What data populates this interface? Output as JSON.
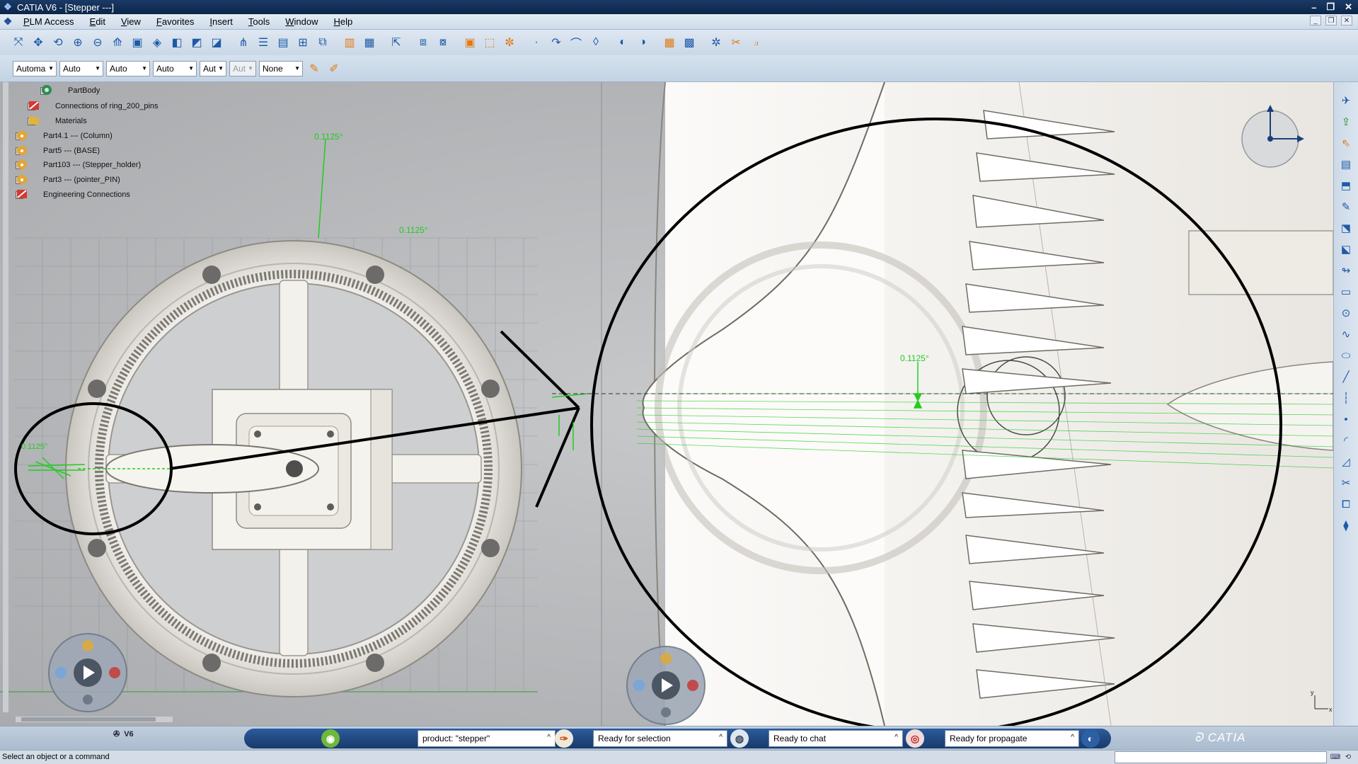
{
  "window": {
    "title": "CATIA V6 - [Stepper ---]",
    "controls": [
      "–",
      "❐",
      "✕"
    ]
  },
  "menu": {
    "items": [
      "PLM Access",
      "Edit",
      "View",
      "Favorites",
      "Insert",
      "Tools",
      "Window",
      "Help"
    ]
  },
  "toolbar2": {
    "combos": [
      "Automa",
      "Auto",
      "Auto",
      "Auto",
      "Aut",
      "Aut",
      "None"
    ]
  },
  "tree": {
    "nodes": [
      {
        "label": "PartBody",
        "icon": "partbody-icon"
      },
      {
        "label": "Connections of ring_200_pins",
        "icon": "connections-icon"
      },
      {
        "label": "Materials",
        "icon": "materials-icon"
      },
      {
        "label": "Part4.1 --- (Column)",
        "icon": "part-icon"
      },
      {
        "label": "Part5 --- (BASE)",
        "icon": "part-icon"
      },
      {
        "label": "Part103 --- (Stepper_holder)",
        "icon": "part-icon"
      },
      {
        "label": "Part3 --- (pointer_PIN)",
        "icon": "part-icon"
      },
      {
        "label": "Engineering Connections",
        "icon": "connections-icon"
      }
    ]
  },
  "annotations": {
    "angle_top": "0.1125°",
    "angle_mid": "0.1125°",
    "angle_zoom": "0.1125°",
    "angle_left": "0.1125°"
  },
  "statusbar": {
    "v6_label": "V6",
    "product": "product: \"stepper\"",
    "selection": "Ready for selection",
    "chat": "Ready to chat",
    "propagate": "Ready for propagate",
    "brand": "CATIA",
    "message": "Select an object or a command"
  },
  "colors": {
    "titlebar": "#0c2548",
    "annotation_green": "#22cc22",
    "statusbar_pill": "#1f4a84"
  }
}
